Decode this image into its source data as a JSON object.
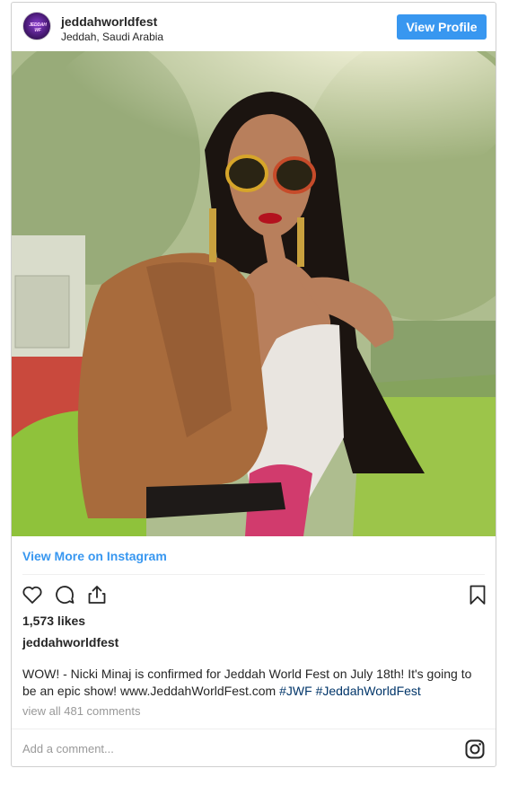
{
  "post": {
    "username": "jeddahworldfest",
    "location": "Jeddah, Saudi Arabia",
    "view_profile_label": "View Profile",
    "avatar_text": "JEDDAH WF",
    "view_more_label": "View More on Instagram",
    "likes": "1,573 likes",
    "author": "jeddahworldfest",
    "caption_text": "WOW! - Nicki Minaj is confirmed for Jeddah World Fest on July 18th! It's going to be an epic show! www.JeddahWorldFest.com",
    "hashtags": [
      "#JWF",
      "#JeddahWorldFest"
    ],
    "view_comments_label": "view all 481 comments",
    "add_comment_placeholder": "Add a comment..."
  },
  "icons": {
    "like": "heart-icon",
    "comment": "comment-icon",
    "share": "share-icon",
    "save": "bookmark-icon",
    "instagram": "instagram-icon"
  },
  "colors": {
    "accent": "#3897f0",
    "hashtag": "#003569",
    "muted": "#999999"
  }
}
